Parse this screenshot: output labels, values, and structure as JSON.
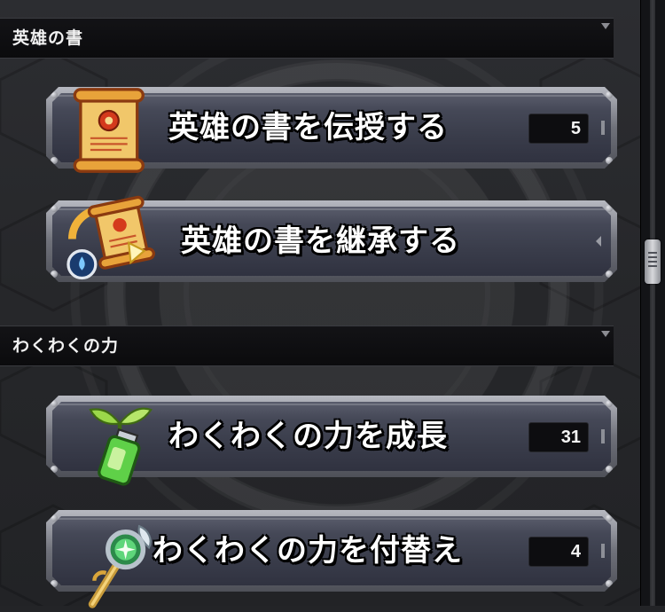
{
  "sections": [
    {
      "title": "英雄の書",
      "items": [
        {
          "label": "英雄の書を伝授する",
          "count": "5",
          "icon": "scroll-icon"
        },
        {
          "label": "英雄の書を継承する",
          "count": null,
          "icon": "scroll-transfer-icon"
        }
      ]
    },
    {
      "title": "わくわくの力",
      "items": [
        {
          "label": "わくわくの力を成長",
          "count": "31",
          "icon": "potion-sprout-icon"
        },
        {
          "label": "わくわくの力を付替え",
          "count": "4",
          "icon": "wand-orb-icon"
        }
      ]
    }
  ],
  "colors": {
    "background": "#232427",
    "button_face": "#454857",
    "header_bg": "#0b0b0d",
    "label_text": "#ffffff"
  }
}
